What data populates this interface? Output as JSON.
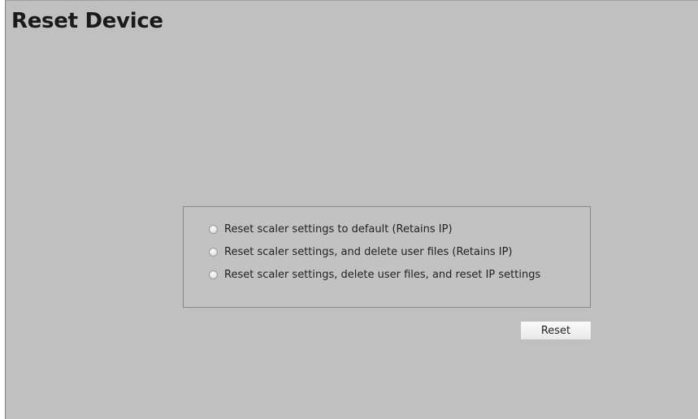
{
  "page": {
    "title": "Reset Device"
  },
  "options": [
    {
      "label": "Reset scaler settings to default (Retains IP)",
      "selected": false
    },
    {
      "label": "Reset scaler settings, and delete user files (Retains IP)",
      "selected": false
    },
    {
      "label": "Reset scaler settings, delete user files, and reset IP settings",
      "selected": false
    }
  ],
  "actions": {
    "reset_label": "Reset"
  },
  "colors": {
    "background": "#c0c0c0",
    "button": "#f2f2f2",
    "text": "#1a1a1a"
  }
}
